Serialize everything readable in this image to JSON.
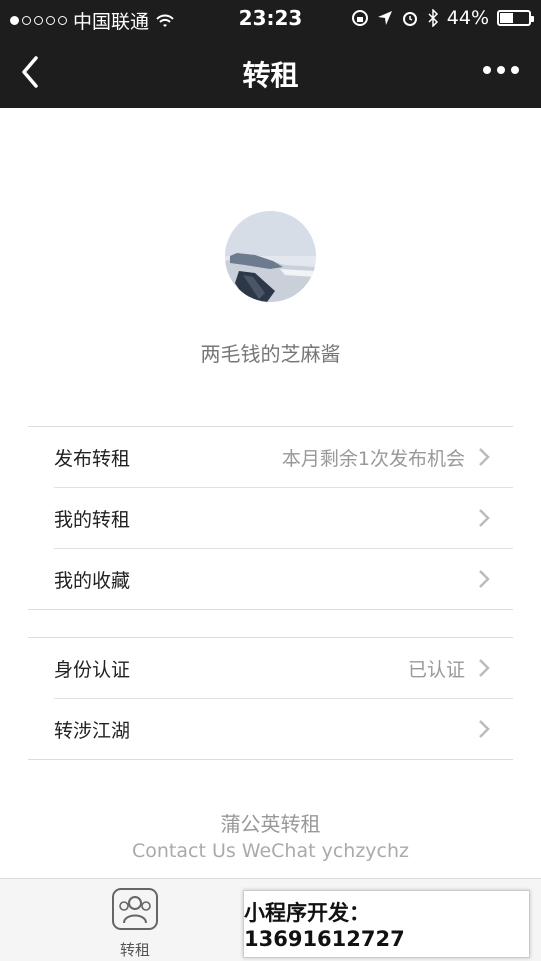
{
  "status_bar": {
    "carrier": "中国联通",
    "time": "23:23",
    "battery": "44%"
  },
  "nav": {
    "title": "转租"
  },
  "profile": {
    "nickname": "两毛钱的芝麻酱"
  },
  "group1": [
    {
      "label": "发布转租",
      "value": "本月剩余1次发布机会"
    },
    {
      "label": "我的转租",
      "value": ""
    },
    {
      "label": "我的收藏",
      "value": ""
    }
  ],
  "group2": [
    {
      "label": "身份认证",
      "value": "已认证"
    },
    {
      "label": "转涉江湖",
      "value": ""
    }
  ],
  "footer": {
    "brand": "蒲公英转租",
    "contact": "Contact Us WeChat ychzychz"
  },
  "tabbar": {
    "tab1_label": "转租"
  },
  "promo": {
    "text": "小程序开发：13691612727"
  },
  "colors": {
    "header_bg": "#1d1d1d",
    "text_primary": "#222222",
    "text_secondary": "#999999"
  }
}
